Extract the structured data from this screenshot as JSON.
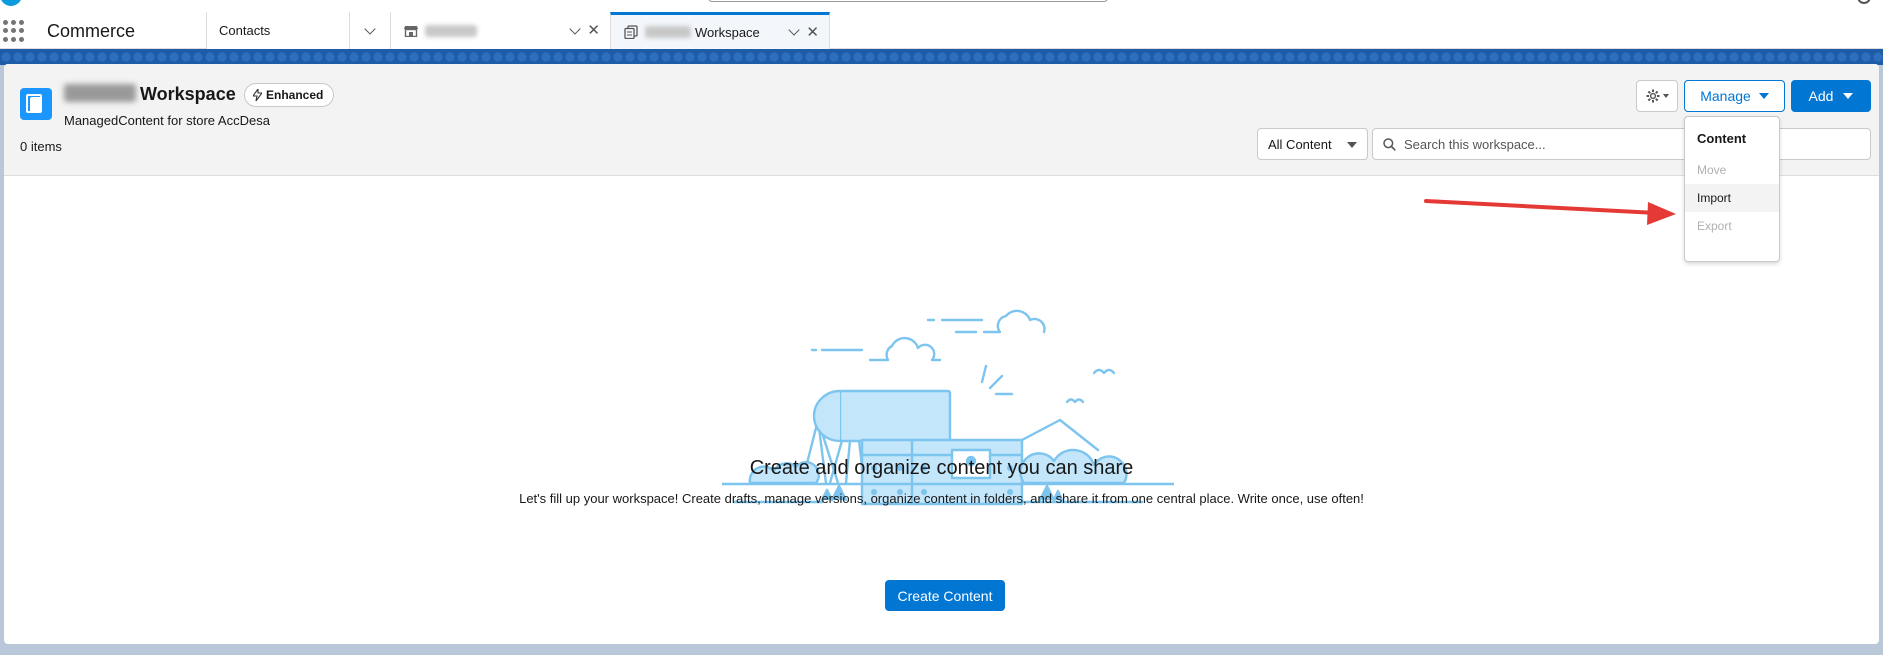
{
  "nav": {
    "app_name": "Commerce",
    "tabs": [
      {
        "label": "Contacts"
      },
      {
        "label": ""
      },
      {
        "label": "Workspace"
      }
    ]
  },
  "header": {
    "title": "Workspace",
    "badge": "Enhanced",
    "subtitle": "ManagedContent for store AccDesa",
    "item_count": "0 items",
    "manage_label": "Manage",
    "add_label": "Add",
    "filter_value": "All Content",
    "search_placeholder": "Search this workspace..."
  },
  "manage_menu": {
    "heading": "Content",
    "items": [
      {
        "label": "Move",
        "disabled": true
      },
      {
        "label": "Import",
        "disabled": false
      },
      {
        "label": "Export",
        "disabled": true
      }
    ]
  },
  "empty_state": {
    "title": "Create and organize content you can share",
    "description": "Let's fill up your workspace! Create drafts, manage versions, organize content in folders, and share it from one central place. Write once, use often!",
    "button_label": "Create Content"
  },
  "colors": {
    "brand": "#0176d3",
    "band": "#1e5ca8",
    "illustration_stroke": "#7dc4ee",
    "illustration_fill": "#c3e6fa",
    "annotation_arrow": "#e53935"
  }
}
